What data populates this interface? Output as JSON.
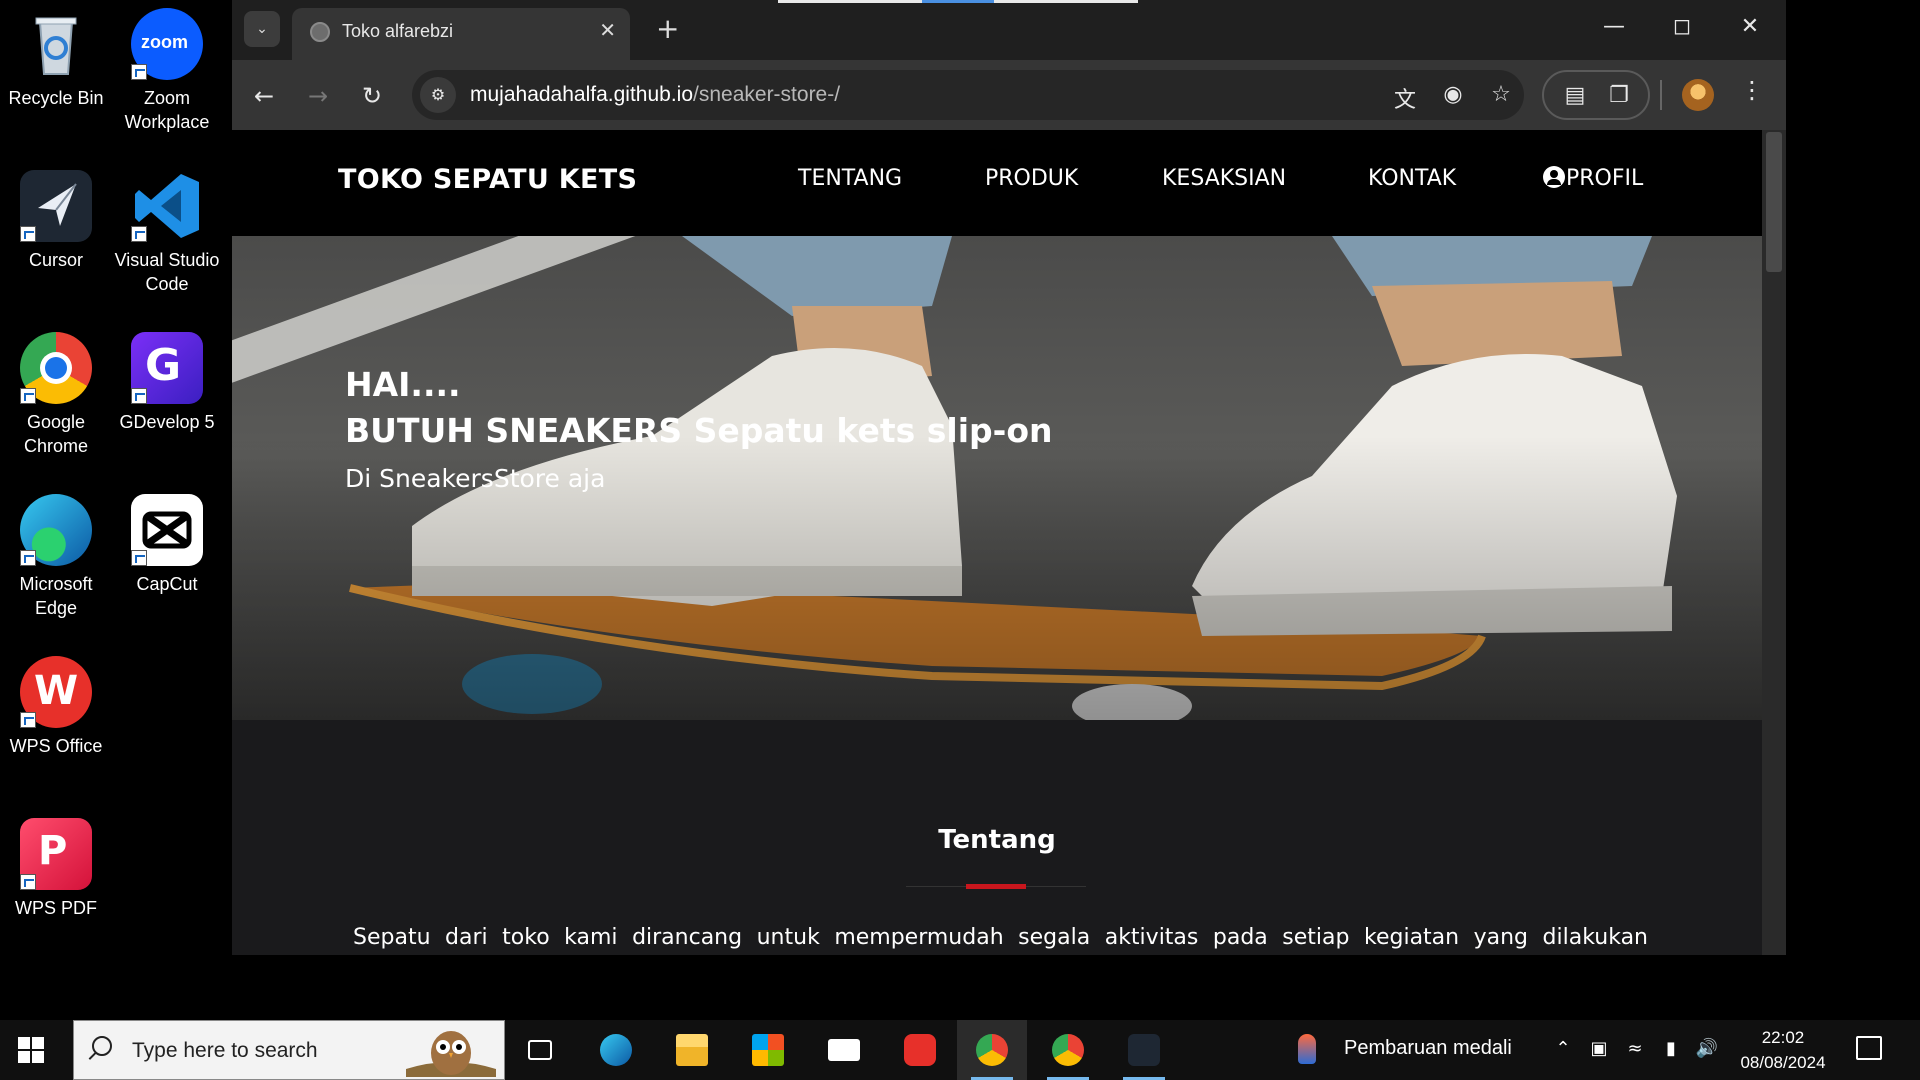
{
  "desktop": {
    "icons": [
      {
        "label": "Recycle Bin",
        "icon": "recycle-bin-icon"
      },
      {
        "label": "Zoom Workplace",
        "icon": "zoom-icon"
      },
      {
        "label": "Cursor",
        "icon": "cursor-app-icon"
      },
      {
        "label": "Visual Studio Code",
        "icon": "vscode-icon"
      },
      {
        "label": "Google Chrome",
        "icon": "chrome-icon"
      },
      {
        "label": "GDevelop 5",
        "icon": "gdevelop-icon"
      },
      {
        "label": "Microsoft Edge",
        "icon": "edge-icon"
      },
      {
        "label": "CapCut",
        "icon": "capcut-icon"
      },
      {
        "label": "WPS Office",
        "icon": "wps-office-icon"
      },
      {
        "label": "WPS PDF",
        "icon": "wps-pdf-icon"
      }
    ]
  },
  "browser": {
    "tab_title": "Toko alfarebzi",
    "url_host": "mujahadahalfa.github.io",
    "url_path": "/sneaker-store-/"
  },
  "site": {
    "brand": "TOKO SEPATU KETS",
    "menu": [
      "TENTANG",
      "PRODUK",
      "KESAKSIAN",
      "KONTAK",
      "PROFIL"
    ],
    "hero": {
      "line1": "HAI....",
      "line2": "BUTUH SNEAKERS Sepatu kets slip-on",
      "sub": "Di SneakersStore aja"
    },
    "about": {
      "title": "Tentang",
      "text": "Sepatu dari toko kami dirancang untuk mempermudah segala aktivitas pada setiap kegiatan yang dilakukan"
    },
    "colors": {
      "accent": "#c8161d",
      "nav_bg": "#000000",
      "page_bg": "#1a1a1c"
    }
  },
  "taskbar": {
    "search_placeholder": "Type here to search",
    "news": "Pembaruan medali",
    "time": "22:02",
    "date": "08/08/2024"
  }
}
